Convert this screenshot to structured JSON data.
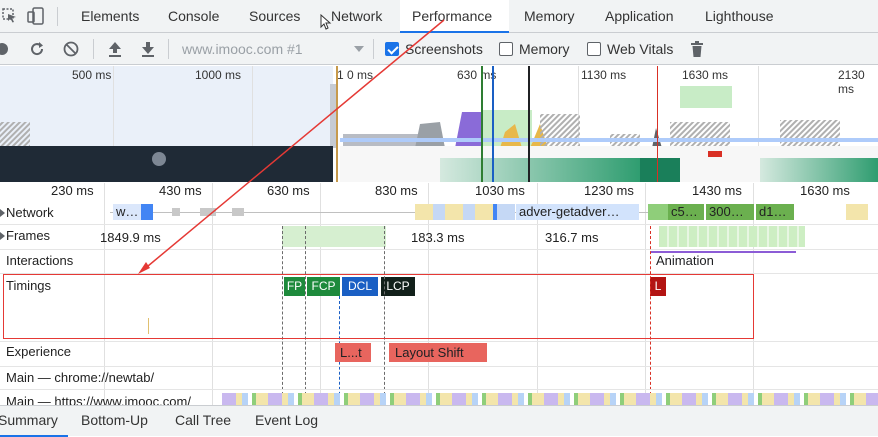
{
  "tabs": [
    "Elements",
    "Console",
    "Sources",
    "Network",
    "Performance",
    "Memory",
    "Application",
    "Lighthouse"
  ],
  "toolbar": {
    "url": "www.imooc.com #1",
    "screenshots_label": "Screenshots",
    "screenshots_checked": true,
    "memory_label": "Memory",
    "memory_checked": false,
    "webvitals_label": "Web Vitals",
    "webvitals_checked": false
  },
  "overview_ticks": [
    "500 ms",
    "1000 ms",
    "1 0 ms",
    "630 ms",
    "1130 ms",
    "1630 ms",
    "2130 ms"
  ],
  "ruler_ticks": [
    "230 ms",
    "430 ms",
    "630 ms",
    "830 ms",
    "1030 ms",
    "1230 ms",
    "1430 ms",
    "1630 ms"
  ],
  "tracks": {
    "network": "Network",
    "frames": "Frames",
    "interactions": "Interactions",
    "timings": "Timings",
    "experience": "Experience",
    "main1": "Main — chrome://newtab/",
    "main2": "Main — https://www.imooc.com/"
  },
  "network_bars": {
    "w": "w…",
    "adver": "adver-getadver…",
    "c5": "c5…",
    "r300": "300…",
    "d1": "d1…"
  },
  "frames": {
    "f1": "1849.9 ms",
    "f2": "183.3 ms",
    "f3": "316.7 ms"
  },
  "interactions": {
    "animation": "Animation"
  },
  "timings": {
    "fp": "FP",
    "fcp": "FCP",
    "dcl": "DCL",
    "lcp": "LCP",
    "l": "L"
  },
  "experience": {
    "ls_short": "L...t",
    "ls": "Layout Shift"
  },
  "bottom_tabs": [
    "Summary",
    "Bottom-Up",
    "Call Tree",
    "Event Log"
  ],
  "colors": {
    "accent": "#1a73e8",
    "fp": "#1e8a3c",
    "fcp": "#1e8a3c",
    "dcl": "#1a5fc4",
    "lcp": "#12201a",
    "l": "#b31412",
    "layout_shift": "#e8655e",
    "annotation": "#e53935"
  }
}
